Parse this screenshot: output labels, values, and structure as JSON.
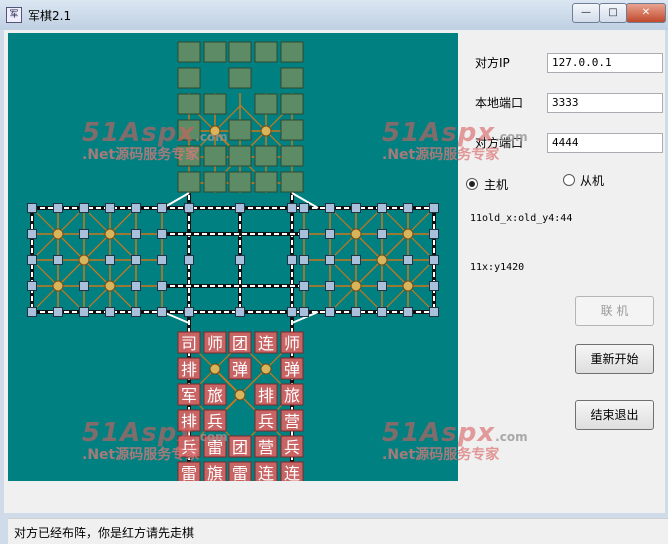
{
  "window": {
    "title": "军棋2.1",
    "icon_glyph": "军",
    "minimize_glyph": "—",
    "maximize_glyph": "□",
    "close_glyph": "✕"
  },
  "form": {
    "peer_ip_label": "对方IP",
    "peer_ip_value": "127.0.0.1",
    "local_port_label": "本地端口",
    "local_port_value": "3333",
    "peer_port_label": "对方端口",
    "peer_port_value": "4444",
    "host_label": "主机",
    "client_label": "从机",
    "selected_role": "host"
  },
  "info": {
    "line1": "11old_x:old_y4:44",
    "line2": "11x:y1420"
  },
  "buttons": {
    "connect": "联 机",
    "restart": "重新开始",
    "quit": "结束退出"
  },
  "status": {
    "text": "对方已经布阵，你是红方请先走棋"
  },
  "watermark": {
    "brand": "51Aspx",
    "domain": ".com",
    "slogan": ".Net源码服务专家"
  },
  "red_pieces": [
    [
      "司",
      "师",
      "团",
      "连",
      "师"
    ],
    [
      "排",
      "",
      "弹",
      "",
      "弹"
    ],
    [
      "军",
      "旅",
      "",
      "排",
      "旅"
    ],
    [
      "排",
      "兵",
      "",
      "兵",
      "营"
    ],
    [
      "兵",
      "雷",
      "团",
      "营",
      "兵"
    ],
    [
      "雷",
      "旗",
      "雷",
      "连",
      "连"
    ]
  ],
  "colors": {
    "board": "#008080",
    "hidden_piece": "#5d8b65",
    "red_piece": "#c86464",
    "rail": "#ffffff",
    "road": "#c8781e",
    "camp": "#d8b45a",
    "station": "#a8c0dc"
  }
}
